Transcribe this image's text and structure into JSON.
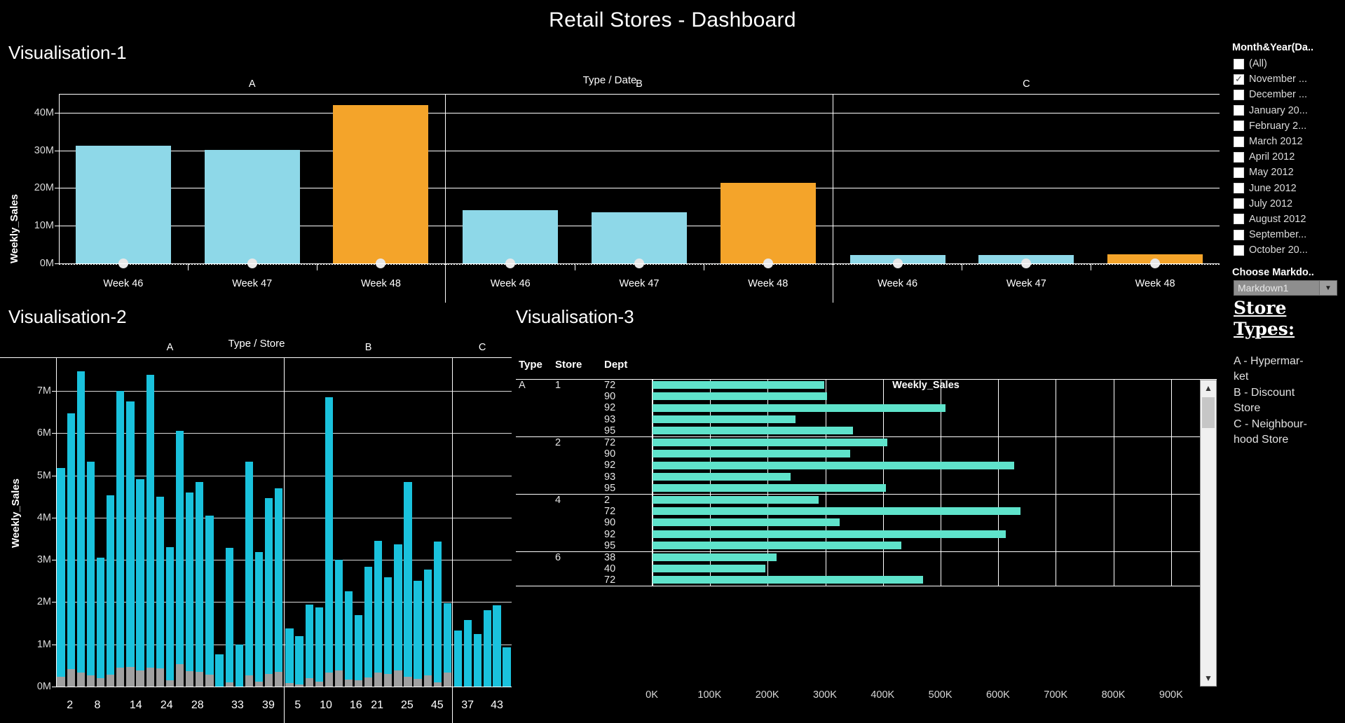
{
  "header": {
    "title": "Retail Stores - Dashboard"
  },
  "colors": {
    "background": "#000000",
    "v1_bar": "#8ed8e8",
    "v1_bar_highlight": "#f4a42a",
    "v1_dot": "#e8e8e8",
    "v2_bar": "#1ac2dd",
    "v2_bar_secondary": "#a0a0a0",
    "v3_bar": "#5fe3cb",
    "gridline": "#ffffff"
  },
  "vis1": {
    "heading": "Visualisation-1",
    "chart_data": {
      "type": "bar",
      "title": "Type / Date",
      "xlabel": "",
      "ylabel": "Weekly_Sales",
      "ylim": [
        0,
        45
      ],
      "ytick_labels": [
        "0M",
        "10M",
        "20M",
        "30M",
        "40M"
      ],
      "ytick_values": [
        0,
        10,
        20,
        30,
        40
      ],
      "panel_label": "Type",
      "categories": [
        "Week 46",
        "Week 47",
        "Week 48"
      ],
      "panels": [
        {
          "name": "A",
          "bars": [
            {
              "category": "Week 46",
              "value": 31.2,
              "highlight": false
            },
            {
              "category": "Week 47",
              "value": 30.1,
              "highlight": false
            },
            {
              "category": "Week 48",
              "value": 42.0,
              "highlight": true
            }
          ]
        },
        {
          "name": "B",
          "bars": [
            {
              "category": "Week 46",
              "value": 14.2,
              "highlight": false
            },
            {
              "category": "Week 47",
              "value": 13.5,
              "highlight": false
            },
            {
              "category": "Week 48",
              "value": 21.4,
              "highlight": true
            }
          ]
        },
        {
          "name": "C",
          "bars": [
            {
              "category": "Week 46",
              "value": 2.3,
              "highlight": false
            },
            {
              "category": "Week 47",
              "value": 2.2,
              "highlight": false
            },
            {
              "category": "Week 48",
              "value": 2.4,
              "highlight": true
            }
          ]
        }
      ],
      "reference_marker": {
        "label": "0M reference dot",
        "value": 0
      }
    }
  },
  "vis2": {
    "heading": "Visualisation-2",
    "chart_data": {
      "type": "bar",
      "title": "Type / Store",
      "xlabel": "Store",
      "ylabel": "Weekly_Sales",
      "ylim": [
        0,
        7.8
      ],
      "ytick_labels": [
        "0M",
        "1M",
        "2M",
        "3M",
        "4M",
        "5M",
        "6M",
        "7M"
      ],
      "ytick_values": [
        0,
        1,
        2,
        3,
        4,
        5,
        6,
        7
      ],
      "series_names": [
        "Weekly_Sales",
        "Markdown"
      ],
      "panels": [
        {
          "name": "A",
          "tick_labels": [
            "2",
            "8",
            "14",
            "24",
            "28",
            "33",
            "39"
          ],
          "bars": [
            {
              "store": "1",
              "value": 5.18,
              "secondary": 0.24
            },
            {
              "store": "2",
              "value": 6.47,
              "secondary": 0.42
            },
            {
              "store": "4",
              "value": 7.47,
              "secondary": 0.33
            },
            {
              "store": "6",
              "value": 5.32,
              "secondary": 0.27
            },
            {
              "store": "8",
              "value": 3.05,
              "secondary": 0.2
            },
            {
              "store": "10",
              "value": 4.53,
              "secondary": 0.29
            },
            {
              "store": "11",
              "value": 7.0,
              "secondary": 0.45
            },
            {
              "store": "13",
              "value": 6.75,
              "secondary": 0.47
            },
            {
              "store": "14",
              "value": 4.91,
              "secondary": 0.39
            },
            {
              "store": "19",
              "value": 7.38,
              "secondary": 0.45
            },
            {
              "store": "20",
              "value": 4.5,
              "secondary": 0.43
            },
            {
              "store": "24",
              "value": 3.31,
              "secondary": 0.15
            },
            {
              "store": "26",
              "value": 6.05,
              "secondary": 0.53
            },
            {
              "store": "27",
              "value": 4.6,
              "secondary": 0.36
            },
            {
              "store": "28",
              "value": 4.85,
              "secondary": 0.35
            },
            {
              "store": "31",
              "value": 4.05,
              "secondary": 0.29
            },
            {
              "store": "32",
              "value": 0.77,
              "secondary": 0.0
            },
            {
              "store": "33",
              "value": 3.29,
              "secondary": 0.1
            },
            {
              "store": "34",
              "value": 1.0,
              "secondary": 0.0
            },
            {
              "store": "36",
              "value": 5.32,
              "secondary": 0.26
            },
            {
              "store": "39",
              "value": 3.19,
              "secondary": 0.11
            },
            {
              "store": "40",
              "value": 4.46,
              "secondary": 0.3
            },
            {
              "store": "41",
              "value": 4.69,
              "secondary": 0.35
            }
          ]
        },
        {
          "name": "B",
          "tick_labels": [
            "5",
            "10",
            "16",
            "21",
            "25",
            "45"
          ],
          "bars": [
            {
              "store": "3",
              "value": 1.38,
              "secondary": 0.08
            },
            {
              "store": "5",
              "value": 1.2,
              "secondary": 0.05
            },
            {
              "store": "7",
              "value": 1.94,
              "secondary": 0.2
            },
            {
              "store": "9",
              "value": 1.87,
              "secondary": 0.12
            },
            {
              "store": "10",
              "value": 6.86,
              "secondary": 0.34
            },
            {
              "store": "12",
              "value": 3.0,
              "secondary": 0.38
            },
            {
              "store": "15",
              "value": 2.26,
              "secondary": 0.16
            },
            {
              "store": "16",
              "value": 1.7,
              "secondary": 0.15
            },
            {
              "store": "17",
              "value": 2.84,
              "secondary": 0.22
            },
            {
              "store": "18",
              "value": 3.45,
              "secondary": 0.33
            },
            {
              "store": "21",
              "value": 2.59,
              "secondary": 0.3
            },
            {
              "store": "22",
              "value": 3.37,
              "secondary": 0.39
            },
            {
              "store": "23",
              "value": 4.85,
              "secondary": 0.24
            },
            {
              "store": "25",
              "value": 2.5,
              "secondary": 0.18
            },
            {
              "store": "29",
              "value": 2.78,
              "secondary": 0.26
            },
            {
              "store": "35",
              "value": 3.44,
              "secondary": 0.1
            },
            {
              "store": "45",
              "value": 1.98,
              "secondary": 0.33
            }
          ]
        },
        {
          "name": "C",
          "tick_labels": [
            "37",
            "43"
          ],
          "bars": [
            {
              "store": "30",
              "value": 1.32,
              "secondary": 0.0
            },
            {
              "store": "37",
              "value": 1.57,
              "secondary": 0.0
            },
            {
              "store": "38",
              "value": 1.25,
              "secondary": 0.0
            },
            {
              "store": "42",
              "value": 1.81,
              "secondary": 0.0
            },
            {
              "store": "43",
              "value": 1.93,
              "secondary": 0.0
            },
            {
              "store": "44",
              "value": 0.93,
              "secondary": 0.0
            }
          ]
        }
      ]
    }
  },
  "vis3": {
    "heading": "Visualisation-3",
    "chart_data": {
      "type": "bar",
      "orientation": "horizontal",
      "xlabel": "Weekly_Sales",
      "xtick_labels": [
        "0K",
        "100K",
        "200K",
        "300K",
        "400K",
        "500K",
        "600K",
        "700K",
        "800K",
        "900K"
      ],
      "xtick_values": [
        0,
        100,
        200,
        300,
        400,
        500,
        600,
        700,
        800,
        900
      ],
      "xlim": [
        0,
        950
      ],
      "columns": [
        "Type",
        "Store",
        "Dept"
      ],
      "groups": [
        {
          "type": "A",
          "store": "1",
          "rows": [
            {
              "dept": "72",
              "value": 298
            },
            {
              "dept": "90",
              "value": 303
            },
            {
              "dept": "92",
              "value": 508
            },
            {
              "dept": "93",
              "value": 248
            },
            {
              "dept": "95",
              "value": 348
            }
          ]
        },
        {
          "type": "",
          "store": "2",
          "rows": [
            {
              "dept": "72",
              "value": 408
            },
            {
              "dept": "90",
              "value": 343
            },
            {
              "dept": "92",
              "value": 628
            },
            {
              "dept": "93",
              "value": 240
            },
            {
              "dept": "95",
              "value": 405
            }
          ]
        },
        {
          "type": "",
          "store": "4",
          "rows": [
            {
              "dept": "2",
              "value": 288
            },
            {
              "dept": "72",
              "value": 638
            },
            {
              "dept": "90",
              "value": 325
            },
            {
              "dept": "92",
              "value": 613
            },
            {
              "dept": "95",
              "value": 432
            }
          ]
        },
        {
          "type": "",
          "store": "6",
          "rows": [
            {
              "dept": "38",
              "value": 215
            },
            {
              "dept": "40",
              "value": 196
            },
            {
              "dept": "72",
              "value": 470
            }
          ]
        }
      ]
    },
    "scrollbar": {
      "up_icon": "chevron-up-icon",
      "down_icon": "chevron-down-icon"
    }
  },
  "rail": {
    "filter_title": "Month&Year(Da..",
    "filter_items": [
      {
        "label": "(All)",
        "checked": false
      },
      {
        "label": "November ...",
        "checked": true
      },
      {
        "label": "December ...",
        "checked": false
      },
      {
        "label": "January 20...",
        "checked": false
      },
      {
        "label": "February 2...",
        "checked": false
      },
      {
        "label": "March 2012",
        "checked": false
      },
      {
        "label": "April 2012",
        "checked": false
      },
      {
        "label": "May 2012",
        "checked": false
      },
      {
        "label": "June 2012",
        "checked": false
      },
      {
        "label": "July 2012",
        "checked": false
      },
      {
        "label": "August 2012",
        "checked": false
      },
      {
        "label": "September...",
        "checked": false
      },
      {
        "label": "October 20...",
        "checked": false
      }
    ],
    "markdown_title": "Choose Markdo..",
    "markdown_value": "Markdown1",
    "markdown_arrow": "chevron-down-icon",
    "store_types_heading": "Store Types:",
    "store_types_lines": [
      "A - Hypermar-",
      "ket",
      "B - Discount",
      "Store",
      "C - Neighbour-",
      "hood Store"
    ]
  }
}
